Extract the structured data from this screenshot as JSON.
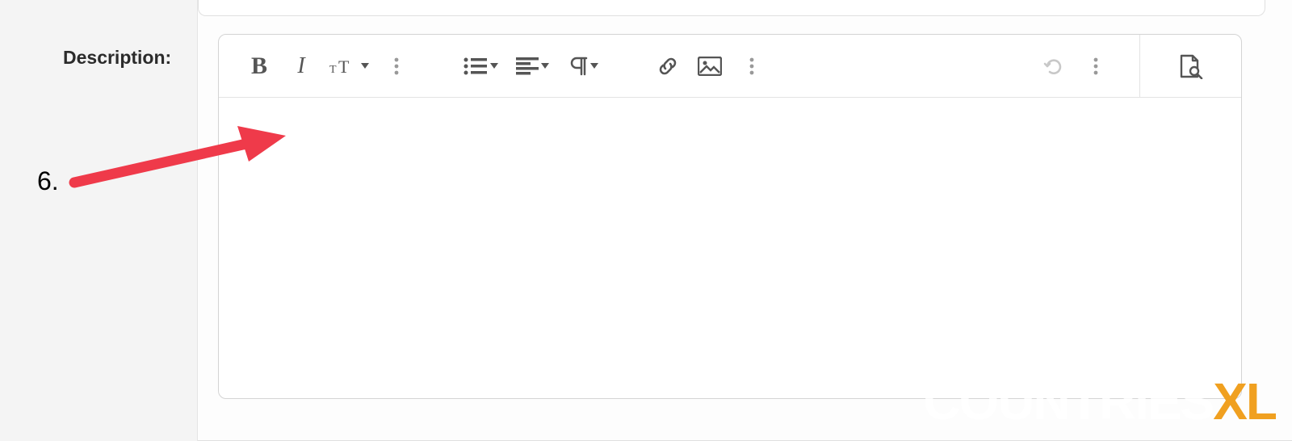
{
  "field": {
    "label": "Description:"
  },
  "annotation": {
    "step": "6."
  },
  "toolbar": {
    "bold": "B",
    "italic": "I"
  },
  "watermark": {
    "part1": "COUNTRIES",
    "part2": "XL"
  },
  "editor": {
    "content": ""
  }
}
